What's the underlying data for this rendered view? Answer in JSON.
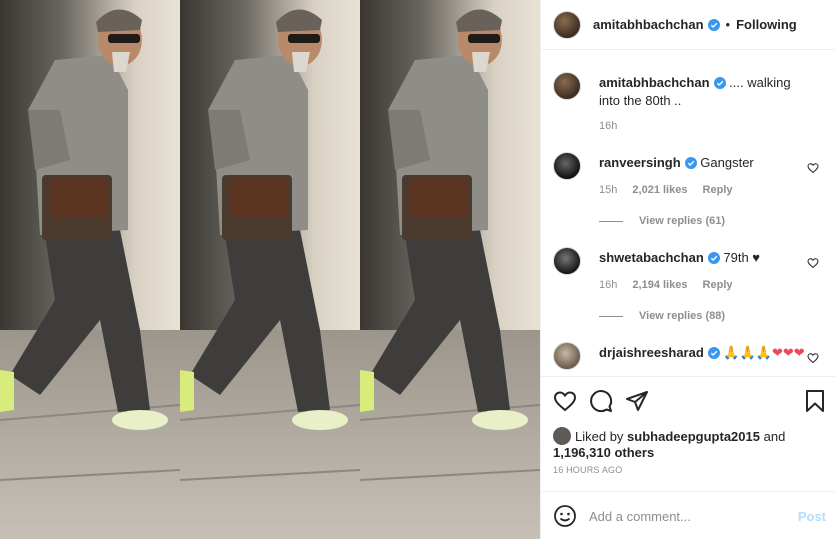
{
  "post": {
    "author": "amitabhbachchan",
    "follow_status": "Following",
    "separator": "•",
    "caption": ".... walking into the 80th ..",
    "caption_time": "16h"
  },
  "comments": [
    {
      "user": "ranveersingh",
      "text": "Gangster",
      "time": "15h",
      "likes": "2,021 likes",
      "reply": "Reply",
      "view_replies": "View replies (61)"
    },
    {
      "user": "shwetabachchan",
      "text": "79th ♥",
      "time": "16h",
      "likes": "2,194 likes",
      "reply": "Reply",
      "view_replies": "View replies (88)"
    },
    {
      "user": "drjaishreesharad",
      "text": "🙏🙏🙏❤❤❤"
    }
  ],
  "likes_summary": {
    "prefix": "Liked by",
    "user": "subhadeepgupta2015",
    "and": "and",
    "others": "1,196,310 others"
  },
  "timestamp": "16 HOURS AGO",
  "comment_box": {
    "placeholder": "Add a comment...",
    "post_label": "Post"
  },
  "colors": {
    "verified": "#3897f0",
    "post_disabled": "#b2dffc",
    "heart": "#ed4956"
  }
}
